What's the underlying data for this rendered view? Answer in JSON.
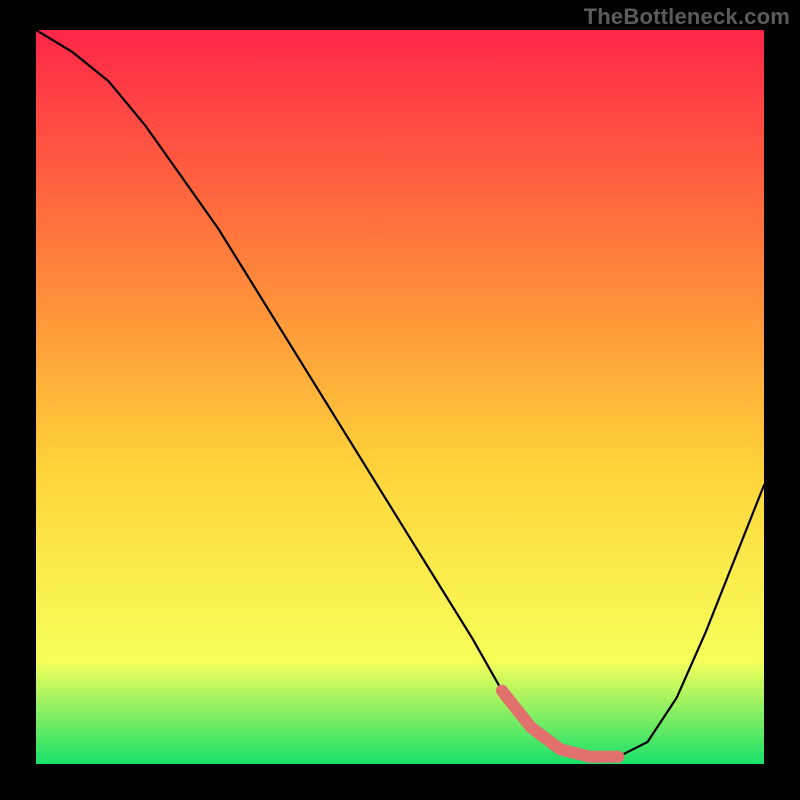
{
  "watermark": "TheBottleneck.com",
  "colors": {
    "gradient_top": "#ff2648",
    "gradient_mid_upper": "#ff8a3a",
    "gradient_mid": "#ffd43a",
    "gradient_lower": "#f6ff5a",
    "gradient_bottom": "#18e06a",
    "curve": "#000000",
    "highlight": "#e2706d",
    "frame": "#000000"
  },
  "chart_data": {
    "type": "line",
    "title": "",
    "xlabel": "",
    "ylabel": "",
    "xlim": [
      0,
      100
    ],
    "ylim": [
      0,
      100
    ],
    "x": [
      0,
      5,
      10,
      15,
      20,
      25,
      30,
      35,
      40,
      45,
      50,
      55,
      60,
      64,
      68,
      72,
      76,
      80,
      84,
      88,
      92,
      96,
      100
    ],
    "values": [
      100,
      97,
      93,
      87,
      80,
      73,
      65,
      57,
      49,
      41,
      33,
      25,
      17,
      10,
      5,
      2,
      1,
      1,
      3,
      9,
      18,
      28,
      38
    ],
    "optimal_range_x": [
      64,
      80
    ],
    "optimal_range_values": [
      10,
      5,
      2,
      1,
      1
    ]
  }
}
